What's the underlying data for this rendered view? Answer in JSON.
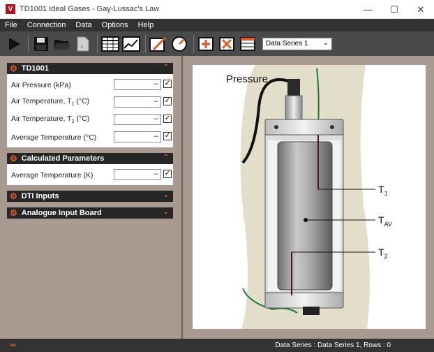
{
  "window": {
    "title": "TD1001 Ideal Gases - Gay-Lussac's Law"
  },
  "menu": [
    "File",
    "Connection",
    "Data",
    "Options",
    "Help"
  ],
  "toolbar": {
    "series_select": "Data Series 1",
    "icons": [
      "play-icon",
      "save-icon",
      "open-folder-icon",
      "export-excel-icon",
      "table-icon",
      "chart-icon",
      "edit-chart-icon",
      "gauge-icon",
      "add-series-icon",
      "delete-series-icon",
      "series-table-icon"
    ]
  },
  "sections": {
    "td1001": {
      "title": "TD1001",
      "rows": [
        {
          "label": "Air Pressure (kPa)",
          "value": "--",
          "checked": true
        },
        {
          "label_html": "Air Temperature, T",
          "sub": "1",
          "suffix": " (°C)",
          "value": "--",
          "checked": true
        },
        {
          "label_html": "Air Temperature, T",
          "sub": "2",
          "suffix": " (°C)",
          "value": "--",
          "checked": true
        },
        {
          "label": "Average Temperature (°C)",
          "value": "--",
          "checked": true
        }
      ]
    },
    "calculated": {
      "title": "Calculated Parameters",
      "rows": [
        {
          "label": "Average Temperature (K)",
          "value": "--",
          "checked": true
        }
      ]
    },
    "dti": {
      "title": "DTI Inputs"
    },
    "analogue": {
      "title": "Analogue Input Board"
    }
  },
  "diagram": {
    "pressure_label": "Pressure",
    "t1": "T",
    "t1_sub": "1",
    "tav": "T",
    "tav_sub": "AV",
    "t2": "T",
    "t2_sub": "2"
  },
  "status": {
    "text": "Data Series : Data Series 1,  Rows : 0"
  },
  "colors": {
    "accent": "#e05a2a",
    "dark": "#333333",
    "bg": "#a89a90"
  }
}
